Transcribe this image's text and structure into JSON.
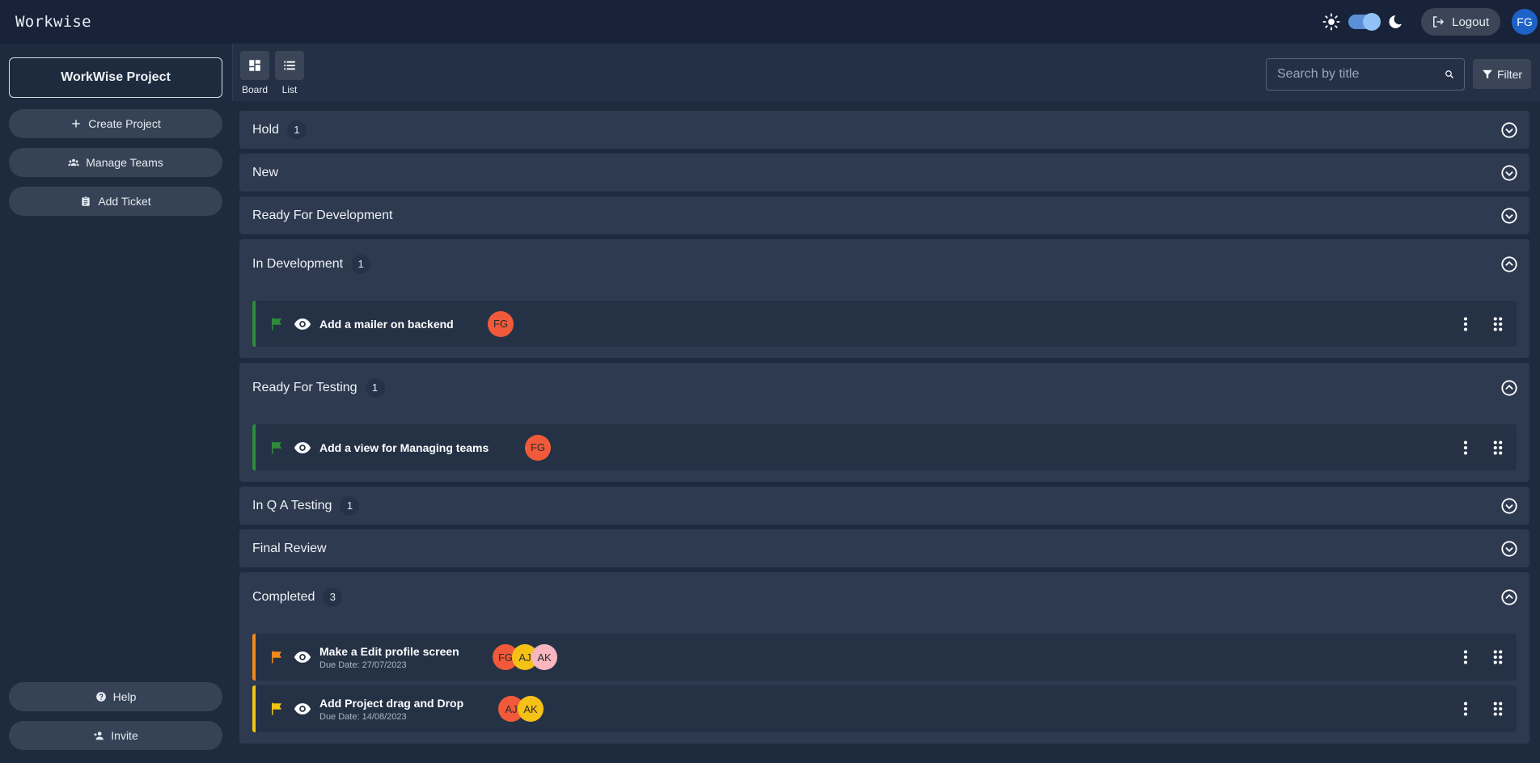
{
  "app": {
    "brand": "Workwise"
  },
  "topbar": {
    "logout_label": "Logout",
    "user_initials": "FG",
    "theme_icons": [
      "sun-icon",
      "moon-icon"
    ],
    "theme_mode": "dark"
  },
  "sidebar": {
    "project_name": "WorkWise Project",
    "buttons": [
      {
        "label": "Create Project",
        "icon": "plus-icon"
      },
      {
        "label": "Manage Teams",
        "icon": "people-icon"
      },
      {
        "label": "Add Ticket",
        "icon": "clipboard-icon"
      }
    ],
    "bottom_buttons": [
      {
        "label": "Help",
        "icon": "help-icon"
      },
      {
        "label": "Invite",
        "icon": "person-add-icon"
      }
    ]
  },
  "toolbar": {
    "views": [
      {
        "label": "Board",
        "icon": "dashboard-icon"
      },
      {
        "label": "List",
        "icon": "list-icon"
      }
    ],
    "search_placeholder": "Search by title",
    "filter_label": "Filter"
  },
  "colors": {
    "flag_green": "#2f8b3c",
    "flag_orange": "#f08a1c",
    "flag_yellow": "#f3c515",
    "avatar_fg": "#f05a3a",
    "avatar_aj": "#f5c117",
    "avatar_ak": "#f7b6c0"
  },
  "groups": [
    {
      "title": "Hold",
      "count": "1",
      "expanded": false
    },
    {
      "title": "New",
      "count": "",
      "expanded": false
    },
    {
      "title": "Ready For Development",
      "count": "",
      "expanded": false
    },
    {
      "title": "In Development",
      "count": "1",
      "expanded": true,
      "tickets": [
        {
          "title": "Add a mailer on backend",
          "due": "",
          "flag": "green",
          "assignees": [
            "FG"
          ]
        }
      ]
    },
    {
      "title": "Ready For Testing",
      "count": "1",
      "expanded": true,
      "tickets": [
        {
          "title": "Add a view for Managing teams",
          "due": "",
          "flag": "green",
          "assignees": [
            "FG"
          ]
        }
      ]
    },
    {
      "title": "In Q A Testing",
      "count": "1",
      "expanded": false
    },
    {
      "title": "Final Review",
      "count": "",
      "expanded": false
    },
    {
      "title": "Completed",
      "count": "3",
      "expanded": true,
      "tickets": [
        {
          "title": "Make a Edit profile screen",
          "due": "Due Date: 27/07/2023",
          "flag": "orange",
          "assignees": [
            "FG",
            "AJ",
            "AK"
          ]
        },
        {
          "title": "Add Project drag and Drop",
          "due": "Due Date: 14/08/2023",
          "flag": "yellow",
          "assignees": [
            "AJ",
            "AK"
          ]
        }
      ]
    }
  ]
}
